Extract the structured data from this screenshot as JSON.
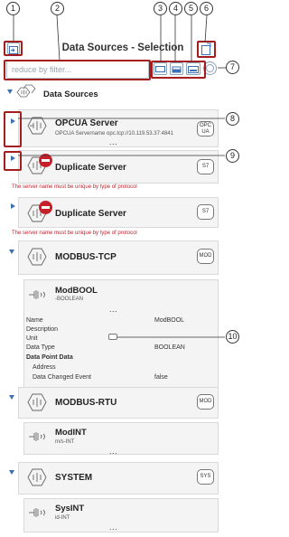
{
  "callouts": [
    "1",
    "2",
    "3",
    "4",
    "5",
    "6",
    "7",
    "8",
    "9",
    "10"
  ],
  "header": {
    "title": "Data Sources - Selection"
  },
  "filter": {
    "placeholder": "reduce by filter..."
  },
  "root": {
    "label": "Data Sources"
  },
  "servers": [
    {
      "name": "OPCUA Server",
      "subtitle": "OPCUA Servername opc.tcp://10.119.53.37:4841",
      "badge": "OPC UA",
      "error": ""
    },
    {
      "name": "Duplicate Server",
      "subtitle": "",
      "badge": "S7",
      "error": "The server name must be unique by type of protocol"
    },
    {
      "name": "Duplicate Server",
      "subtitle": "",
      "badge": "S7",
      "error": "The server name must be unique by type of protocol"
    },
    {
      "name": "MODBUS-TCP",
      "subtitle": "",
      "badge": "MOD",
      "error": ""
    },
    {
      "name": "MODBUS-RTU",
      "subtitle": "",
      "badge": "MOD",
      "error": ""
    },
    {
      "name": "SYSTEM",
      "subtitle": "",
      "badge": "SYS",
      "error": ""
    }
  ],
  "tags": [
    {
      "name": "ModBOOL",
      "type": "-BOOLEAN"
    },
    {
      "name": "ModINT",
      "type": "m/s-INT"
    },
    {
      "name": "SysINT",
      "type": "id-INT"
    }
  ],
  "details": {
    "rows": [
      {
        "label": "Name",
        "value": "ModBOOL"
      },
      {
        "label": "Description",
        "value": ""
      },
      {
        "label": "Unit",
        "value": ""
      },
      {
        "label": "Data Type",
        "value": "BOOLEAN"
      },
      {
        "label": "Data Point Data",
        "value": ""
      },
      {
        "label": "Address",
        "value": ""
      },
      {
        "label": "Data Changed Event",
        "value": "false"
      }
    ]
  },
  "more": "...",
  "colors": {
    "accent": "#3b6fb6",
    "highlight": "#a51e1e",
    "error": "#c8202a"
  }
}
